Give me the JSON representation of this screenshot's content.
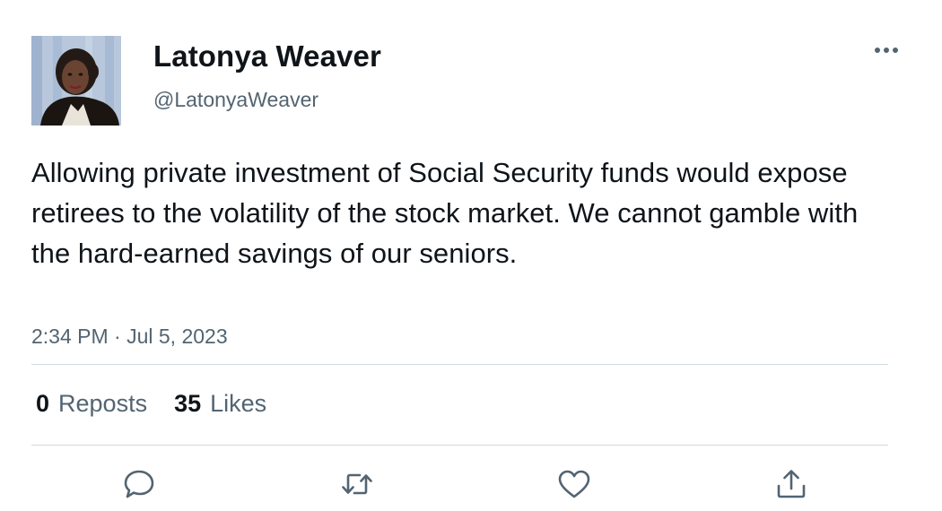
{
  "author": {
    "display_name": "Latonya Weaver",
    "handle": "@LatonyaWeaver"
  },
  "tweet": {
    "text": "Allowing private investment of Social Security funds would expose retirees to the volatility of the stock market. We cannot gamble with the hard-earned savings of our seniors.",
    "timestamp": "2:34 PM · Jul 5, 2023"
  },
  "stats": {
    "reposts_count": "0",
    "reposts_label": "Reposts",
    "likes_count": "35",
    "likes_label": "Likes"
  },
  "icons": {
    "more": "more-horizontal-icon",
    "reply": "reply-icon",
    "repost": "repost-icon",
    "like": "heart-icon",
    "share": "share-icon"
  },
  "colors": {
    "text": "#0f1419",
    "secondary_text": "#536471",
    "divider": "#cfd9de",
    "icon": "#536471"
  }
}
